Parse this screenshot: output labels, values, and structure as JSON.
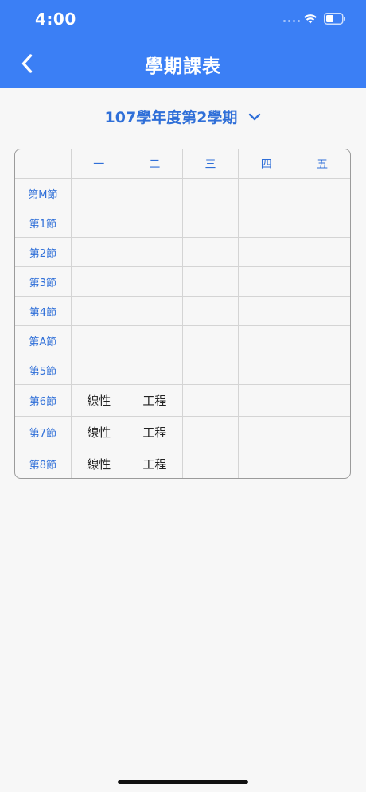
{
  "status_bar": {
    "time": "4:00"
  },
  "header": {
    "title": "學期課表",
    "back_icon": "chevron-left-icon"
  },
  "semester": {
    "label": "107學年度第2學期",
    "icon": "chevron-down-icon"
  },
  "colors": {
    "header_bg": "#3b7ff5",
    "accent": "#2f6fd8",
    "background": "#f7f7f7"
  },
  "schedule": {
    "days": [
      "一",
      "二",
      "三",
      "四",
      "五"
    ],
    "periods": [
      {
        "label": "第M節",
        "cells": [
          "",
          "",
          "",
          "",
          ""
        ]
      },
      {
        "label": "第1節",
        "cells": [
          "",
          "",
          "",
          "",
          ""
        ]
      },
      {
        "label": "第2節",
        "cells": [
          "",
          "",
          "",
          "",
          ""
        ]
      },
      {
        "label": "第3節",
        "cells": [
          "",
          "",
          "",
          "",
          ""
        ]
      },
      {
        "label": "第4節",
        "cells": [
          "",
          "",
          "",
          "",
          ""
        ]
      },
      {
        "label": "第A節",
        "cells": [
          "",
          "",
          "",
          "",
          ""
        ]
      },
      {
        "label": "第5節",
        "cells": [
          "",
          "",
          "",
          "",
          ""
        ]
      },
      {
        "label": "第6節",
        "cells": [
          "線性",
          "工程",
          "",
          "",
          ""
        ]
      },
      {
        "label": "第7節",
        "cells": [
          "線性",
          "工程",
          "",
          "",
          ""
        ]
      },
      {
        "label": "第8節",
        "cells": [
          "線性",
          "工程",
          "",
          "",
          ""
        ]
      }
    ]
  }
}
